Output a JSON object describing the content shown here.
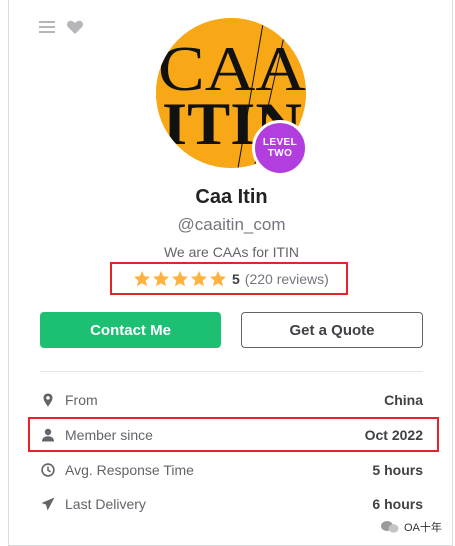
{
  "profile": {
    "avatar_text_lines": [
      "CAA",
      "ITIN"
    ],
    "level_badge": [
      "LEVEL",
      "TWO"
    ],
    "name": "Caa Itin",
    "username": "@caaitin_com",
    "tagline": "We are CAAs for ITIN"
  },
  "rating": {
    "stars": 5,
    "score": "5",
    "reviews": "(220 reviews)",
    "star_color": "#FFB33E"
  },
  "actions": {
    "contact": "Contact Me",
    "quote": "Get a Quote"
  },
  "stats": [
    {
      "icon": "location-pin-icon",
      "label": "From",
      "value": "China"
    },
    {
      "icon": "user-icon",
      "label": "Member since",
      "value": "Oct 2022"
    },
    {
      "icon": "clock-icon",
      "label": "Avg. Response Time",
      "value": "5 hours"
    },
    {
      "icon": "send-icon",
      "label": "Last Delivery",
      "value": "6 hours"
    }
  ],
  "watermark": "OA十年",
  "colors": {
    "accent_green": "#1dbf73",
    "avatar_bg": "#F8A817",
    "badge_purple": "#b23ee0",
    "highlight_red": "#e5242a"
  }
}
